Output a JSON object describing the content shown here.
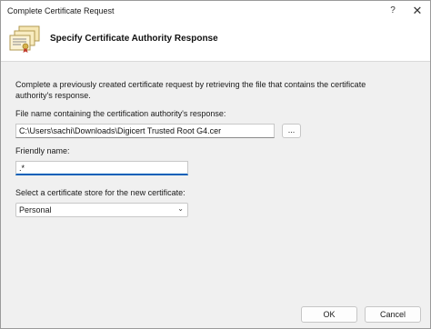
{
  "window": {
    "title": "Complete Certificate Request",
    "help_glyph": "?",
    "close_glyph": "✕"
  },
  "header": {
    "title": "Specify Certificate Authority Response",
    "icon": "certificate-stack-icon"
  },
  "main": {
    "description": "Complete a previously created certificate request by retrieving the file that contains the certificate authority's response.",
    "file_label": "File name containing the certification authority's response:",
    "file_value": "C:\\Users\\sachi\\Downloads\\Digicert Trusted Root G4.cer",
    "browse_label": "...",
    "friendly_label": "Friendly name:",
    "friendly_value": ".*",
    "store_label": "Select a certificate store for the new certificate:",
    "store_selected": "Personal"
  },
  "footer": {
    "ok_label": "OK",
    "cancel_label": "Cancel"
  },
  "colors": {
    "accent": "#005fb8",
    "dialog_bg": "#f0f0f0"
  }
}
